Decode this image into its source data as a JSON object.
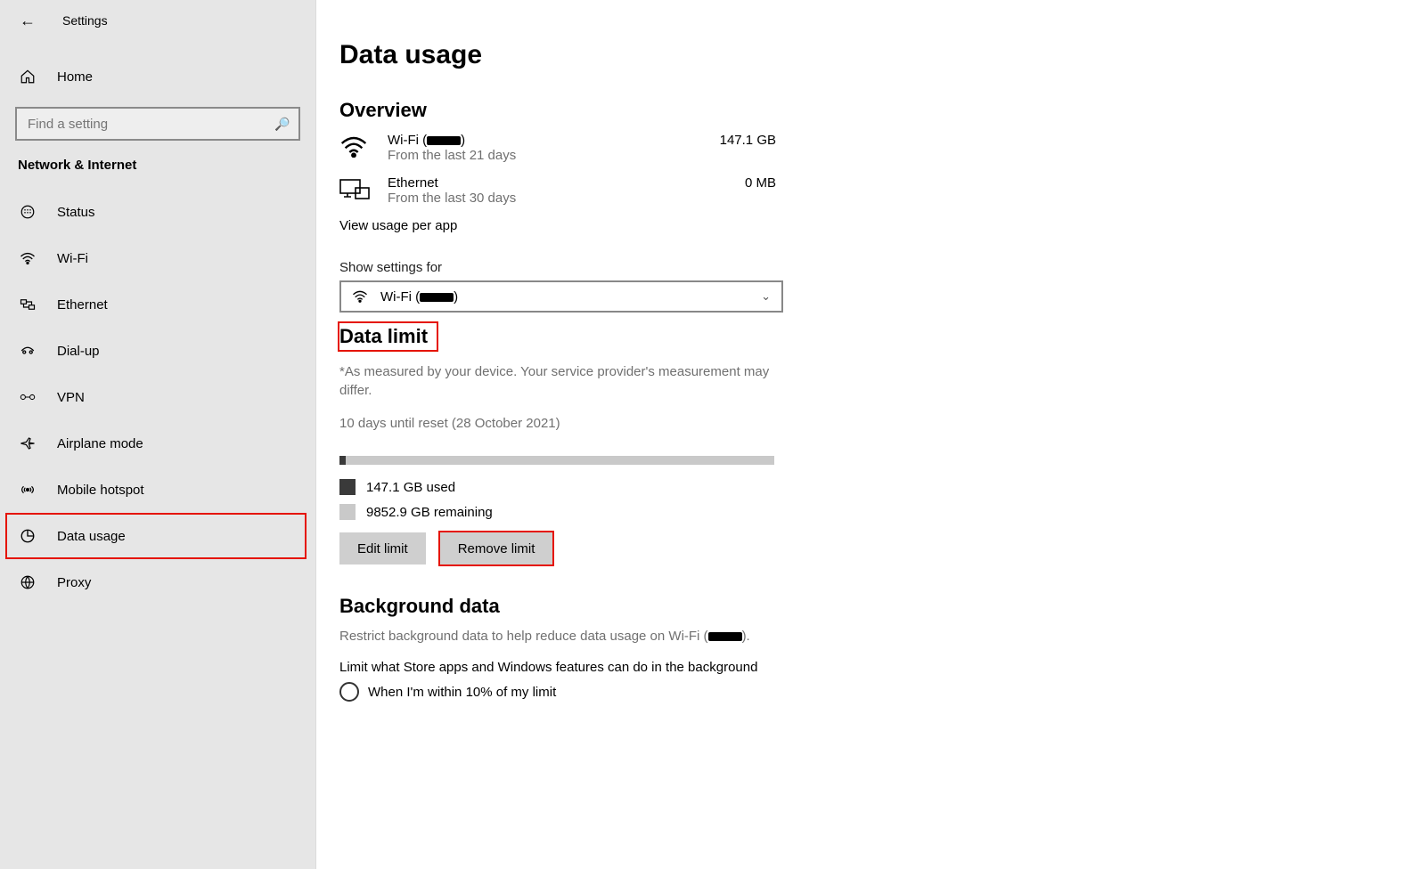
{
  "header": {
    "app_title": "Settings"
  },
  "sidebar": {
    "home_label": "Home",
    "search_placeholder": "Find a setting",
    "category_label": "Network & Internet",
    "items": [
      {
        "label": "Status",
        "icon": "status"
      },
      {
        "label": "Wi-Fi",
        "icon": "wifi"
      },
      {
        "label": "Ethernet",
        "icon": "ethernet"
      },
      {
        "label": "Dial-up",
        "icon": "dialup"
      },
      {
        "label": "VPN",
        "icon": "vpn"
      },
      {
        "label": "Airplane mode",
        "icon": "airplane"
      },
      {
        "label": "Mobile hotspot",
        "icon": "hotspot"
      },
      {
        "label": "Data usage",
        "icon": "datausage",
        "highlight": true
      },
      {
        "label": "Proxy",
        "icon": "proxy"
      }
    ]
  },
  "page": {
    "title": "Data usage",
    "overview_title": "Overview",
    "connections": [
      {
        "name_prefix": "Wi-Fi (",
        "redacted": true,
        "name_suffix": ")",
        "sub": "From the last 21 days",
        "value": "147.1 GB",
        "icon": "wifi"
      },
      {
        "name_prefix": "Ethernet",
        "redacted": false,
        "name_suffix": "",
        "sub": "From the last 30 days",
        "value": "0 MB",
        "icon": "ethernet-pc"
      }
    ],
    "view_per_app": "View usage per app",
    "show_settings_for_label": "Show settings for",
    "dropdown_prefix": "Wi-Fi (",
    "dropdown_suffix": ")",
    "data_limit_title": "Data limit",
    "data_limit_note": "*As measured by your device. Your service provider's measurement may differ.",
    "reset_info": "10 days until reset (28 October 2021)",
    "progress_percent": 1.5,
    "used_text": "147.1 GB used",
    "remaining_text": "9852.9 GB remaining",
    "edit_limit_btn": "Edit limit",
    "remove_limit_btn": "Remove limit",
    "bg_title": "Background data",
    "bg_desc_prefix": "Restrict background data to help reduce data usage on Wi-Fi (",
    "bg_desc_suffix": ").",
    "bg_limit_label": "Limit what Store apps and Windows features can do in the background",
    "radio_option_1": "When I'm within 10% of my limit"
  }
}
